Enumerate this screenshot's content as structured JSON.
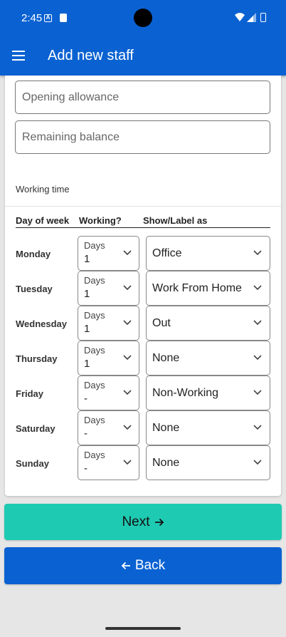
{
  "status_bar": {
    "time": "2:45",
    "notification_icon": "A"
  },
  "app_bar": {
    "title": "Add new staff"
  },
  "form": {
    "opening_allowance_placeholder": "Opening allowance",
    "remaining_balance_placeholder": "Remaining balance"
  },
  "working_time": {
    "section_label": "Working time",
    "headers": {
      "day": "Day of week",
      "working": "Working?",
      "label": "Show/Label as"
    },
    "days_caption": "Days",
    "rows": [
      {
        "day": "Monday",
        "days": "1",
        "label": "Office"
      },
      {
        "day": "Tuesday",
        "days": "1",
        "label": "Work From Home"
      },
      {
        "day": "Wednesday",
        "days": "1",
        "label": "Out"
      },
      {
        "day": "Thursday",
        "days": "1",
        "label": "None"
      },
      {
        "day": "Friday",
        "days": "-",
        "label": "Non-Working"
      },
      {
        "day": "Saturday",
        "days": "-",
        "label": "None"
      },
      {
        "day": "Sunday",
        "days": "-",
        "label": "None"
      }
    ]
  },
  "buttons": {
    "next": "Next",
    "back": "Back"
  },
  "colors": {
    "primary": "#0a62d2",
    "accent": "#1fcab3"
  }
}
